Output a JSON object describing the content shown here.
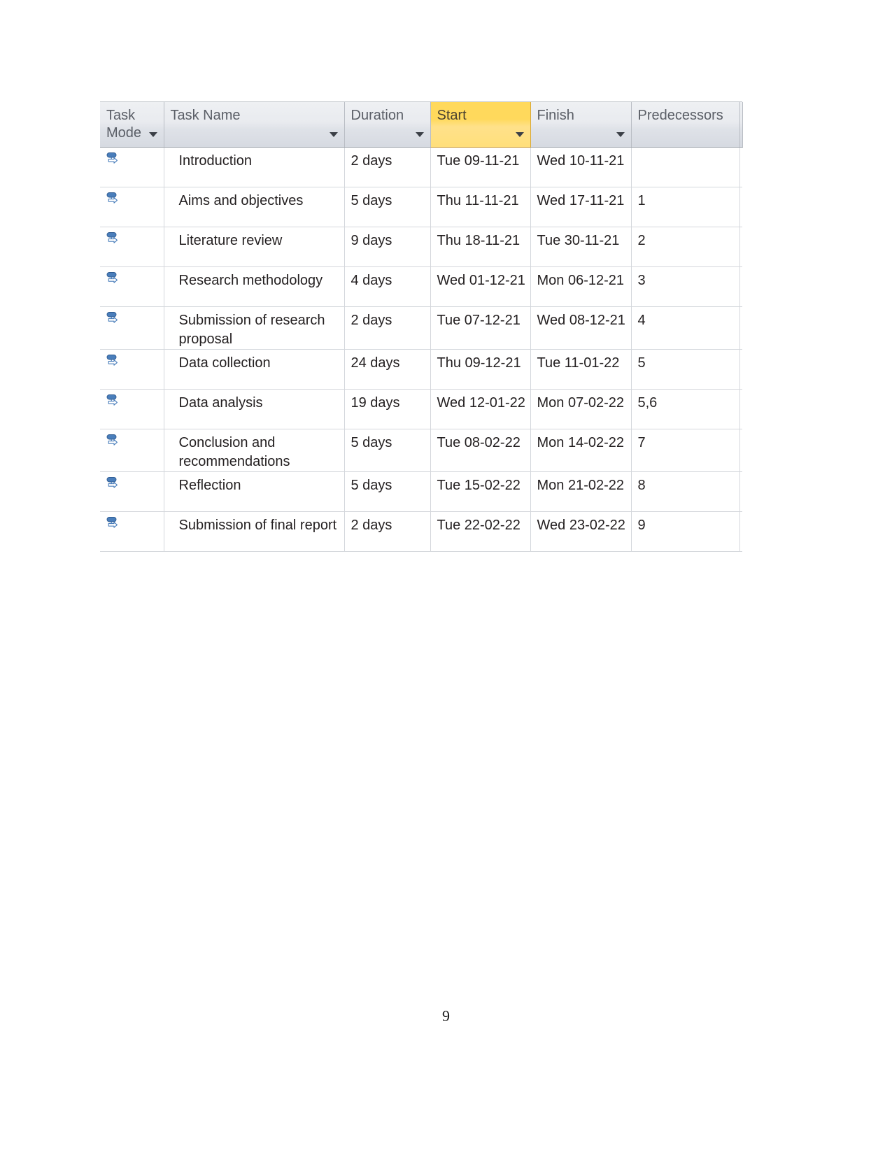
{
  "document": {
    "page_number": "9",
    "background_color": "#ffffff"
  },
  "project_table": {
    "selected_column": "Start",
    "colors": {
      "header_gradient_top": "#eef0f3",
      "header_gradient_bottom": "#d6dae1",
      "header_text": "#5a5e66",
      "selected_header_top": "#ffd95c",
      "selected_header_bottom": "#ffdf7b",
      "selected_header_border": "#d9a93a",
      "grid_line": "#d4d7dc",
      "body_text": "#231f20",
      "task_mode_icon": "#4a7ebb"
    },
    "columns": [
      {
        "key": "task_mode",
        "label": "Task Mode",
        "has_filter": true,
        "selected": false
      },
      {
        "key": "task_name",
        "label": "Task Name",
        "has_filter": true,
        "selected": false
      },
      {
        "key": "duration",
        "label": "Duration",
        "has_filter": true,
        "selected": false
      },
      {
        "key": "start",
        "label": "Start",
        "has_filter": true,
        "selected": true
      },
      {
        "key": "finish",
        "label": "Finish",
        "has_filter": true,
        "selected": false
      },
      {
        "key": "predecessors",
        "label": "Predecessors",
        "has_filter": false,
        "selected": false
      },
      {
        "key": "clipped",
        "label": "",
        "has_filter": false,
        "selected": false
      }
    ],
    "rows": [
      {
        "task_mode_icon": "manually-scheduled-icon",
        "task_name": "Introduction",
        "duration": "2 days",
        "start": "Tue 09-11-21",
        "finish": "Wed 10-11-21",
        "predecessors": ""
      },
      {
        "task_mode_icon": "manually-scheduled-icon",
        "task_name": "Aims and objectives",
        "duration": "5 days",
        "start": "Thu 11-11-21",
        "finish": "Wed 17-11-21",
        "predecessors": "1"
      },
      {
        "task_mode_icon": "manually-scheduled-icon",
        "task_name": "Literature review",
        "duration": "9 days",
        "start": "Thu 18-11-21",
        "finish": "Tue 30-11-21",
        "predecessors": "2"
      },
      {
        "task_mode_icon": "manually-scheduled-icon",
        "task_name": "Research methodology",
        "duration": "4 days",
        "start": "Wed 01-12-21",
        "finish": "Mon 06-12-21",
        "predecessors": "3"
      },
      {
        "task_mode_icon": "manually-scheduled-icon",
        "task_name": "Submission of research proposal",
        "duration": "2 days",
        "start": "Tue 07-12-21",
        "finish": "Wed 08-12-21",
        "predecessors": "4"
      },
      {
        "task_mode_icon": "manually-scheduled-icon",
        "task_name": "Data collection",
        "duration": "24 days",
        "start": "Thu 09-12-21",
        "finish": "Tue 11-01-22",
        "predecessors": "5"
      },
      {
        "task_mode_icon": "manually-scheduled-icon",
        "task_name": "Data analysis",
        "duration": "19 days",
        "start": "Wed 12-01-22",
        "finish": "Mon 07-02-22",
        "predecessors": "5,6"
      },
      {
        "task_mode_icon": "manually-scheduled-icon",
        "task_name": "Conclusion and recommendations",
        "duration": "5 days",
        "start": "Tue 08-02-22",
        "finish": "Mon 14-02-22",
        "predecessors": "7"
      },
      {
        "task_mode_icon": "manually-scheduled-icon",
        "task_name": "Reflection",
        "duration": "5 days",
        "start": "Tue 15-02-22",
        "finish": "Mon 21-02-22",
        "predecessors": "8"
      },
      {
        "task_mode_icon": "manually-scheduled-icon",
        "task_name": "Submission of final report",
        "duration": "2 days",
        "start": "Tue 22-02-22",
        "finish": "Wed 23-02-22",
        "predecessors": "9"
      }
    ]
  }
}
